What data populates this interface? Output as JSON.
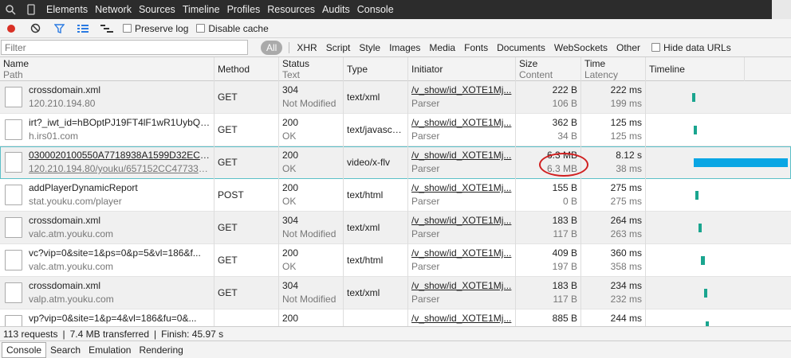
{
  "tabs": [
    "Elements",
    "Network",
    "Sources",
    "Timeline",
    "Profiles",
    "Resources",
    "Audits",
    "Console"
  ],
  "toolbar": {
    "preserve_log": "Preserve log",
    "disable_cache": "Disable cache"
  },
  "filter": {
    "placeholder": "Filter",
    "all": "All",
    "types": [
      "XHR",
      "Script",
      "Style",
      "Images",
      "Media",
      "Fonts",
      "Documents",
      "WebSockets",
      "Other"
    ],
    "hide_data_urls": "Hide data URLs"
  },
  "columns": {
    "name": "Name",
    "path": "Path",
    "method": "Method",
    "status": "Status",
    "text": "Text",
    "type": "Type",
    "initiator": "Initiator",
    "size": "Size",
    "content": "Content",
    "time": "Time",
    "latency": "Latency",
    "timeline": "Timeline"
  },
  "rows": [
    {
      "name": "crossdomain.xml",
      "path": "120.210.194.80",
      "method": "GET",
      "status": "304",
      "status_text": "Not Modified",
      "type": "text/xml",
      "initiator": "/v_show/id_XOTE1Mj...",
      "initiator_sub": "Parser",
      "size": "222 B",
      "content": "106 B",
      "time": "222 ms",
      "latency": "199 ms",
      "timeline_start": 0.32,
      "timeline_width": 0.02
    },
    {
      "name": "irt?_iwt_id=hBOptPJ19FT4lF1wR1UybQA...",
      "path": "h.irs01.com",
      "method": "GET",
      "status": "200",
      "status_text": "OK",
      "type": "text/javascri...",
      "initiator": "/v_show/id_XOTE1Mj...",
      "initiator_sub": "Parser",
      "size": "362 B",
      "content": "34 B",
      "time": "125 ms",
      "latency": "125 ms",
      "timeline_start": 0.33,
      "timeline_width": 0.02
    },
    {
      "name": "0300020100550A7718938A1599D32ECEE...",
      "path": "120.210.194.80/youku/657152CC477338...",
      "method": "GET",
      "status": "200",
      "status_text": "OK",
      "type": "video/x-flv",
      "initiator": "/v_show/id_XOTE1Mj...",
      "initiator_sub": "Parser",
      "size": "6.3 MB",
      "content": "6.3 MB",
      "time": "8.12 s",
      "latency": "38 ms",
      "timeline_start": 0.33,
      "timeline_width": 0.65
    },
    {
      "name": "addPlayerDynamicReport",
      "path": "stat.youku.com/player",
      "method": "POST",
      "status": "200",
      "status_text": "OK",
      "type": "text/html",
      "initiator": "/v_show/id_XOTE1Mj...",
      "initiator_sub": "Parser",
      "size": "155 B",
      "content": "0 B",
      "time": "275 ms",
      "latency": "275 ms",
      "timeline_start": 0.34,
      "timeline_width": 0.02
    },
    {
      "name": "crossdomain.xml",
      "path": "valc.atm.youku.com",
      "method": "GET",
      "status": "304",
      "status_text": "Not Modified",
      "type": "text/xml",
      "initiator": "/v_show/id_XOTE1Mj...",
      "initiator_sub": "Parser",
      "size": "183 B",
      "content": "117 B",
      "time": "264 ms",
      "latency": "263 ms",
      "timeline_start": 0.36,
      "timeline_width": 0.02
    },
    {
      "name": "vc?vip=0&site=1&ps=0&p=5&vl=186&f...",
      "path": "valc.atm.youku.com",
      "method": "GET",
      "status": "200",
      "status_text": "OK",
      "type": "text/html",
      "initiator": "/v_show/id_XOTE1Mj...",
      "initiator_sub": "Parser",
      "size": "409 B",
      "content": "197 B",
      "time": "360 ms",
      "latency": "358 ms",
      "timeline_start": 0.38,
      "timeline_width": 0.03
    },
    {
      "name": "crossdomain.xml",
      "path": "valp.atm.youku.com",
      "method": "GET",
      "status": "304",
      "status_text": "Not Modified",
      "type": "text/xml",
      "initiator": "/v_show/id_XOTE1Mj...",
      "initiator_sub": "Parser",
      "size": "183 B",
      "content": "117 B",
      "time": "234 ms",
      "latency": "232 ms",
      "timeline_start": 0.4,
      "timeline_width": 0.02
    },
    {
      "name": "vp?vip=0&site=1&p=4&vl=186&fu=0&...",
      "path": "",
      "method": "",
      "status": "200",
      "status_text": "",
      "type": "",
      "initiator": "/v_show/id_XOTE1Mj...",
      "initiator_sub": "",
      "size": "885 B",
      "content": "",
      "time": "244 ms",
      "latency": "",
      "timeline_start": 0.41,
      "timeline_width": 0.02
    }
  ],
  "status": {
    "requests": "113 requests",
    "transferred": "7.4 MB transferred",
    "finish": "Finish: 45.97 s"
  },
  "drawer_tabs": [
    "Console",
    "Search",
    "Emulation",
    "Rendering"
  ],
  "colors": {
    "timeline_green": "#1aa58f",
    "timeline_blue": "#0aa6e4",
    "annotation_red": "#d02020"
  }
}
